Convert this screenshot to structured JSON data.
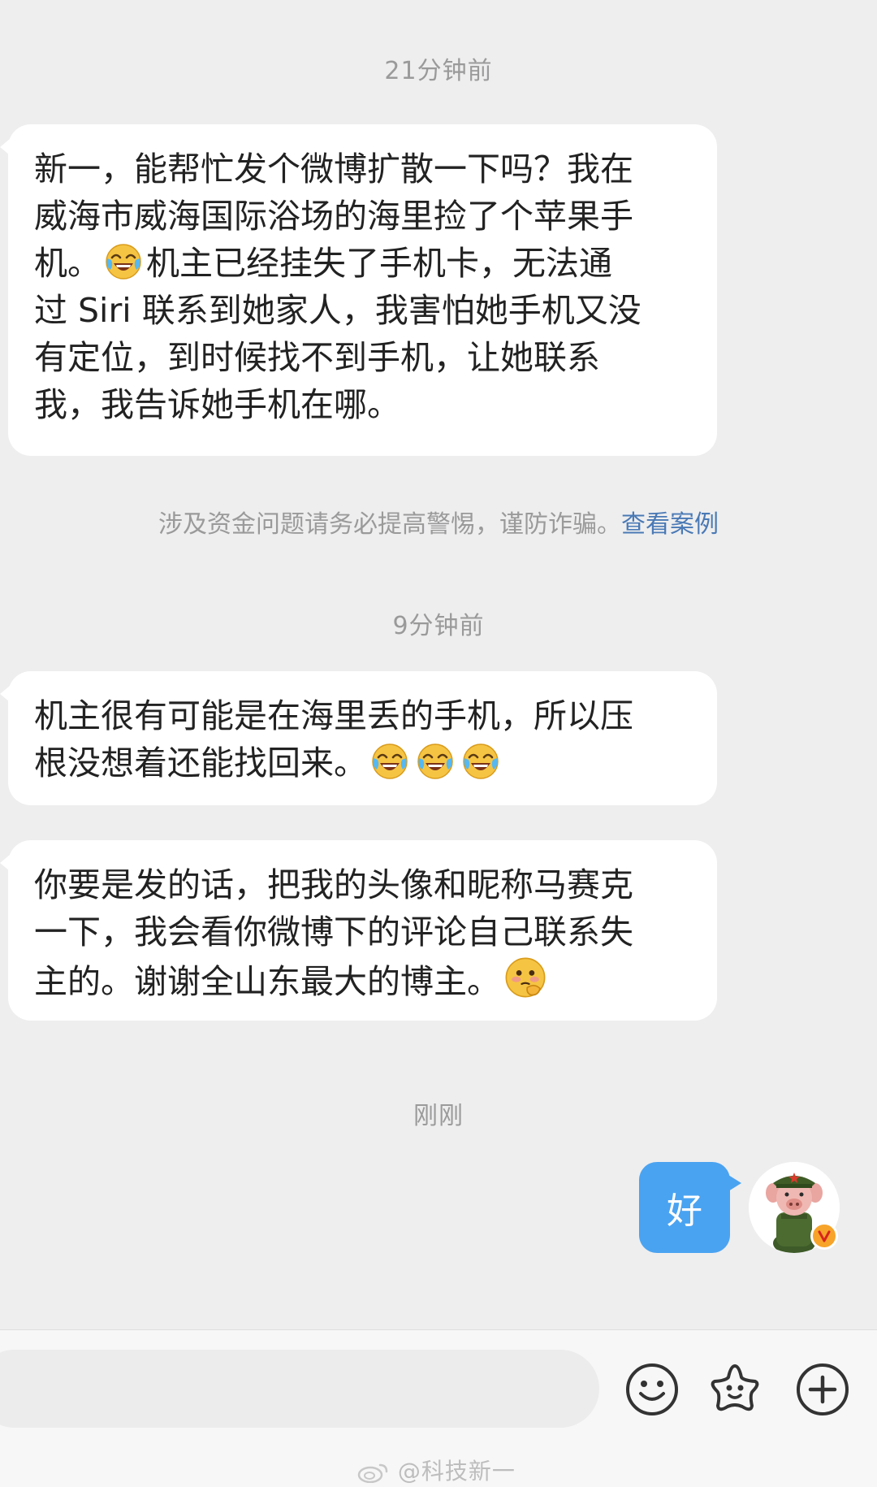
{
  "timestamps": {
    "t1": "21分钟前",
    "t2": "9分钟前",
    "t3": "刚刚"
  },
  "messages": {
    "m1": {
      "line1": "新一，能帮忙发个微博扩散一下吗？我在",
      "line2": "威海市威海国际浴场的海里捡了个苹果手",
      "line3a": "机。",
      "line3b": "机主已经挂失了手机卡，无法通",
      "line4": "过 Siri 联系到她家人，我害怕她手机又没",
      "line5": "有定位，到时候找不到手机，让她联系",
      "line6": "我，我告诉她手机在哪。"
    },
    "m2": {
      "line1": "机主很有可能是在海里丢的手机，所以压",
      "line2": "根没想着还能找回来。"
    },
    "m3": {
      "line1": "你要是发的话，把我的头像和昵称马赛克",
      "line2": "一下，我会看你微博下的评论自己联系失",
      "line3": "主的。谢谢全山东最大的博主。"
    },
    "outgoing": "好"
  },
  "notice": {
    "text": "涉及资金问题请务必提高警惕，谨防诈骗。",
    "link": "查看案例"
  },
  "icons": {
    "emoji_laugh": "laugh-cry-emoji-icon",
    "emoji_think": "thinking-emoji-icon",
    "emoji_button": "smiley-face-icon",
    "sticker_button": "star-sticker-icon",
    "plus_button": "plus-circle-icon",
    "verified_badge": "verified-v-badge-icon",
    "weibo_logo": "weibo-logo-icon"
  },
  "colors": {
    "outgoing_bubble": "#4aa3f1",
    "link": "#4a79b5",
    "verified_badge": "#f7a42a"
  },
  "watermark": "@科技新一"
}
